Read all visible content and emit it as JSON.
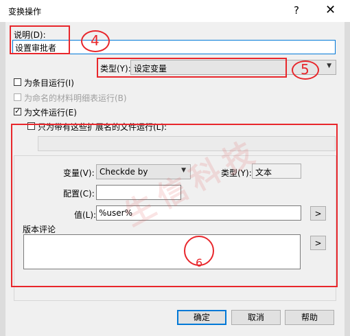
{
  "window": {
    "title": "变换操作",
    "help": "?",
    "close": "✕"
  },
  "description": {
    "label": "说明(D):",
    "value": "设置审批者"
  },
  "type": {
    "label": "类型(Y):",
    "value": "设定变量"
  },
  "options": {
    "per_item": "为条目运行(I)",
    "named_bom": "为命名的材料明细表运行(B)",
    "per_file": "为文件运行(E)",
    "ext_only": "只为带有这些扩展名的文件运行(L):"
  },
  "variable": {
    "label": "变量(V):",
    "value": "Checkde by",
    "type_label": "类型(Y):",
    "type_value": "文本"
  },
  "config": {
    "label": "配置(C):",
    "value": ""
  },
  "value_field": {
    "label": "值(L):",
    "value": "%user%",
    "button": ">"
  },
  "comment": {
    "label": "版本评论",
    "value": "",
    "button": ">"
  },
  "buttons": {
    "ok": "确定",
    "cancel": "取消",
    "help": "帮助"
  },
  "annotations": {
    "n4": "4",
    "n5": "5",
    "n6": "6"
  },
  "watermark": "生信科技",
  "colors": {
    "annotation": "#e8262b",
    "accent": "#0078d7"
  }
}
